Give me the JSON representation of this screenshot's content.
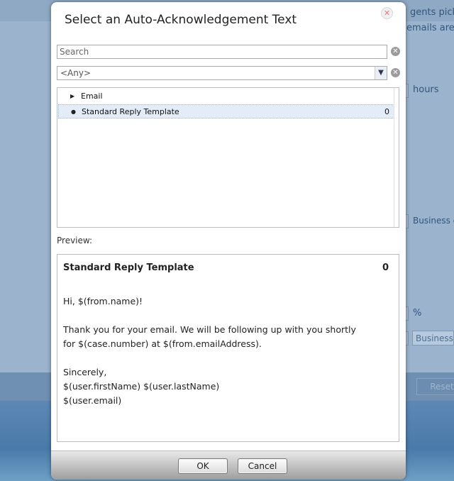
{
  "background": {
    "text1": "gents pick",
    "text2": "emails are",
    "hours_label": "hours",
    "business_days_label": "Business da",
    "percent_label": "%",
    "business_select": "Business c",
    "reset_label": "Reset"
  },
  "dialog": {
    "title": "Select an Auto-Acknowledgement Text",
    "search_placeholder": "Search",
    "filter_value": "<Any>",
    "tree": [
      {
        "label": "Email",
        "count": ""
      },
      {
        "label": "Standard Reply Template",
        "count": "0"
      }
    ],
    "preview_label": "Preview:",
    "preview": {
      "title": "Standard Reply Template",
      "count": "0",
      "lines": [
        "Hi, $(from.name)!",
        "Thank you for your email. We will be following up with you shortly",
        "for $(case.number) at $(from.emailAddress).",
        "Sincerely,",
        "$(user.firstName) $(user.lastName)",
        "$(user.email)"
      ]
    },
    "ok_label": "OK",
    "cancel_label": "Cancel"
  },
  "icons": {
    "close": "close-icon",
    "clear_search": "clear-icon",
    "clear_filter": "clear-icon",
    "dropdown": "chevron-down-icon",
    "expand": "triangle-right-icon",
    "bullet": "bullet-icon"
  }
}
